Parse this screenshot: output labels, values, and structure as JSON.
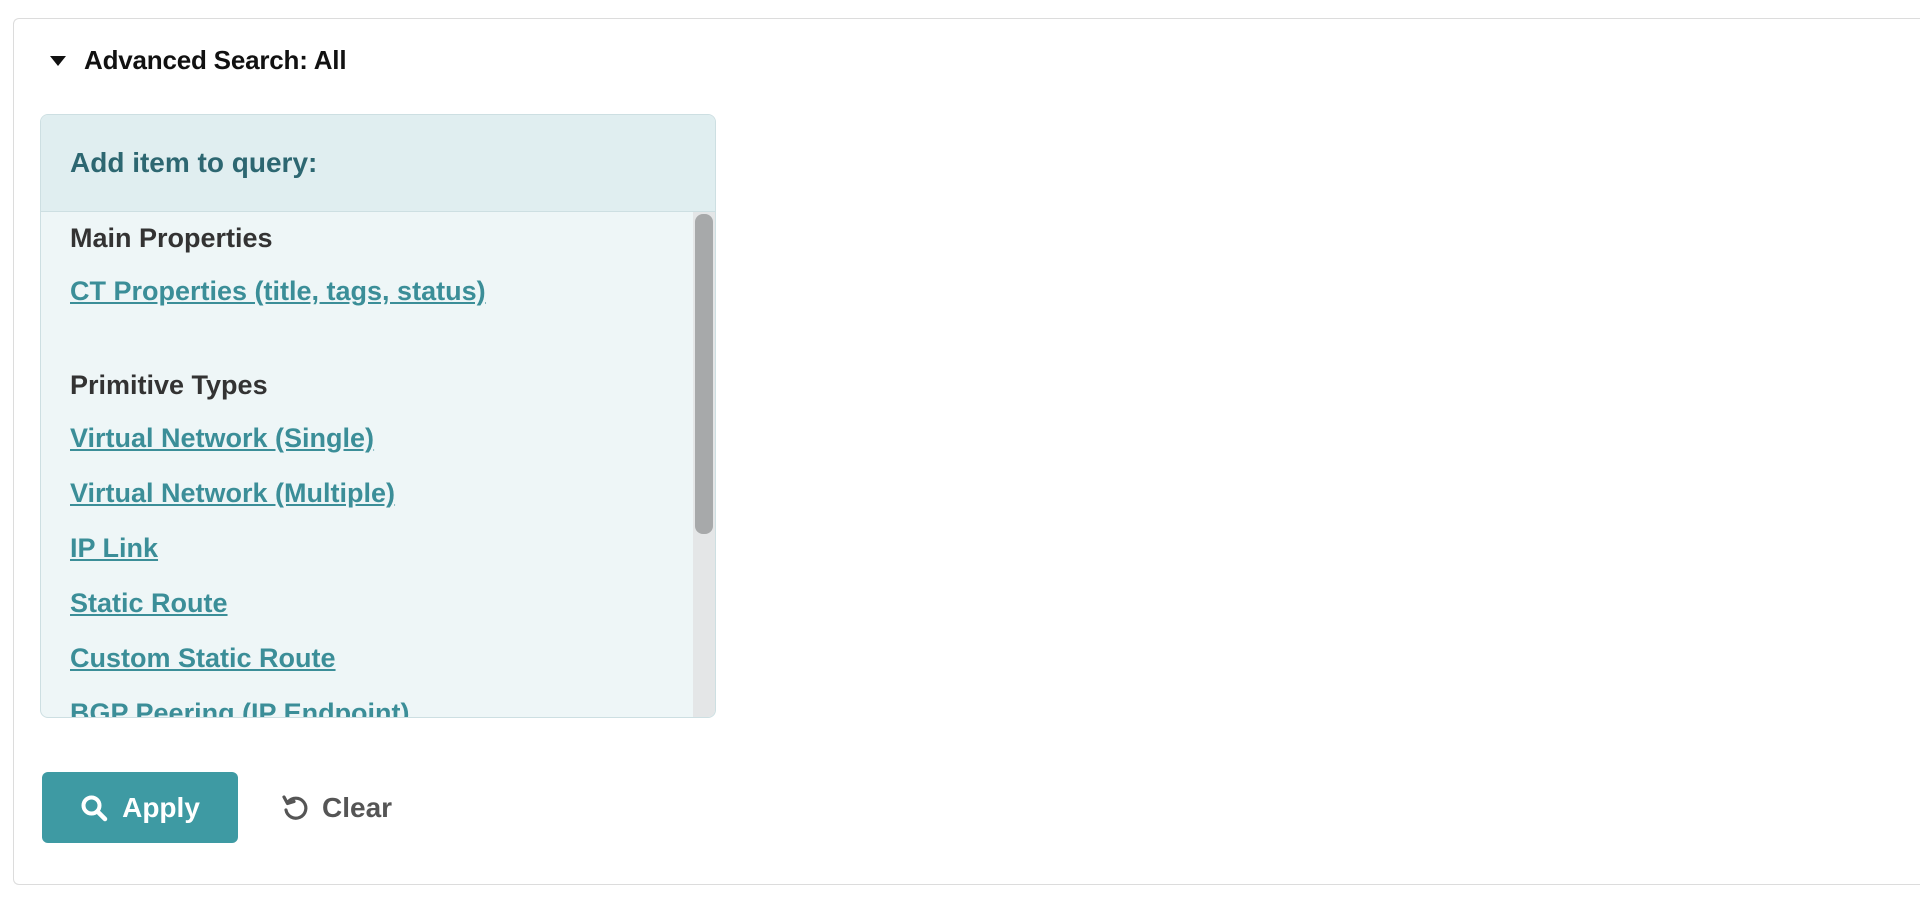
{
  "section": {
    "title": "Advanced Search: All"
  },
  "query_panel": {
    "header": "Add item to query:",
    "groups": [
      {
        "heading": "Main Properties",
        "items": [
          "CT Properties (title, tags, status)"
        ]
      },
      {
        "heading": "Primitive Types",
        "items": [
          "Virtual Network (Single)",
          "Virtual Network (Multiple)",
          "IP Link",
          "Static Route",
          "Custom Static Route",
          "BGP Peering (IP Endpoint)"
        ]
      }
    ]
  },
  "actions": {
    "apply_label": "Apply",
    "clear_label": "Clear"
  },
  "colors": {
    "accent": "#3e9aa3",
    "link": "#3b8e98",
    "panel_header_text": "#2d6771"
  },
  "icons": {
    "toggle": "caret-down-icon",
    "apply": "search-icon",
    "clear": "undo-icon"
  }
}
